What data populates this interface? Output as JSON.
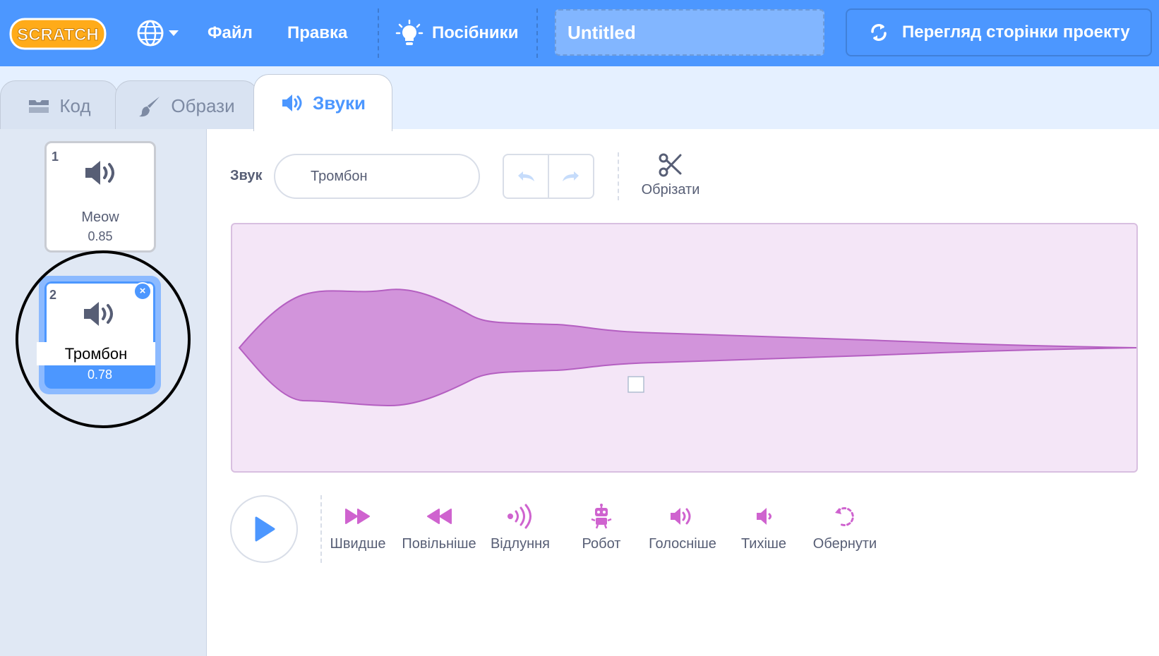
{
  "menubar": {
    "logo_text": "SCRATCH",
    "file": "Файл",
    "edit": "Правка",
    "tutorials": "Посібники",
    "project_title": "Untitled",
    "see_project_page": "Перегляд сторінки проекту",
    "colors": {
      "bar": "#4c97ff",
      "logo": "#ffab19"
    }
  },
  "tabs": [
    {
      "label": "Код",
      "icon": "code-icon"
    },
    {
      "label": "Образи",
      "icon": "brush-icon"
    },
    {
      "label": "Звуки",
      "icon": "speaker-icon",
      "active": true
    }
  ],
  "sounds": [
    {
      "index": "1",
      "name": "Meow",
      "duration": "0.85"
    },
    {
      "index": "2",
      "name": "Тромбон",
      "duration": "0.78",
      "selected": true
    }
  ],
  "editor": {
    "sound_label": "Звук",
    "sound_name": "Тромбон",
    "trim_label": "Обрізати",
    "effects": [
      {
        "label": "Швидше",
        "icon": "faster-icon"
      },
      {
        "label": "Повільніше",
        "icon": "slower-icon"
      },
      {
        "label": "Відлуння",
        "icon": "echo-icon"
      },
      {
        "label": "Робот",
        "icon": "robot-icon"
      },
      {
        "label": "Голосніше",
        "icon": "louder-icon"
      },
      {
        "label": "Тихіше",
        "icon": "softer-icon"
      },
      {
        "label": "Обернути",
        "icon": "reverse-icon"
      }
    ],
    "colors": {
      "accent": "#4c97ff",
      "effect": "#cf63cf",
      "wave_fill": "#d294db",
      "wave_bg": "#f4e6f7"
    }
  }
}
